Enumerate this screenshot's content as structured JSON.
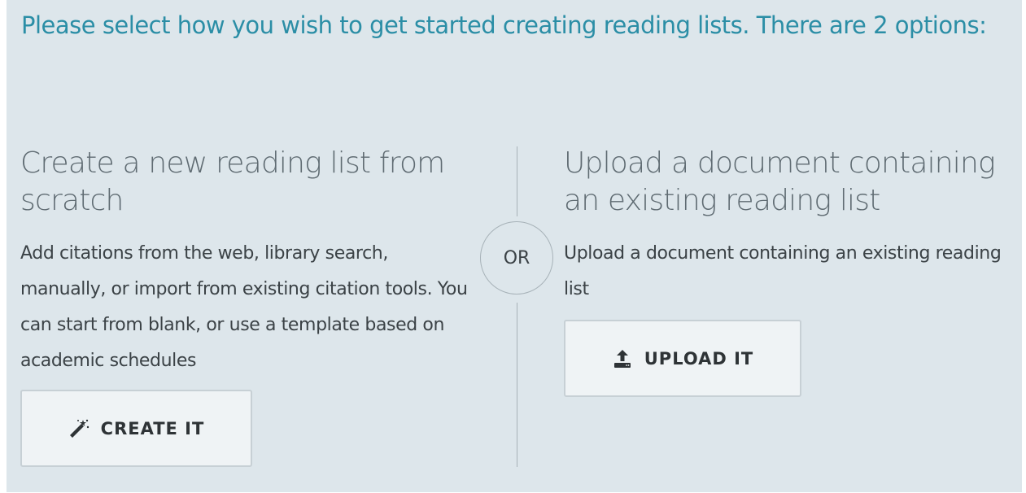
{
  "header": {
    "title": "Please select how you wish to get started creating reading lists. There are 2 options:"
  },
  "create_option": {
    "heading": "Create a new reading list from scratch",
    "description": "Add citations from the web, library search, manually, or import from existing citation tools. You can start from blank, or use a template based on academic schedules",
    "button_label": "CREATE IT",
    "button_icon": "magic-wand-icon"
  },
  "divider": {
    "label": "OR"
  },
  "upload_option": {
    "heading": "Upload a document containing an existing reading list",
    "description": "Upload a document containing an existing reading list",
    "button_label": "UPLOAD IT",
    "button_icon": "upload-icon"
  },
  "colors": {
    "panel_background": "#dde6eb",
    "title_color": "#2b8ea6",
    "heading_color": "#5f6b72",
    "button_background": "#eff3f5",
    "button_border": "#c7d0d5"
  }
}
